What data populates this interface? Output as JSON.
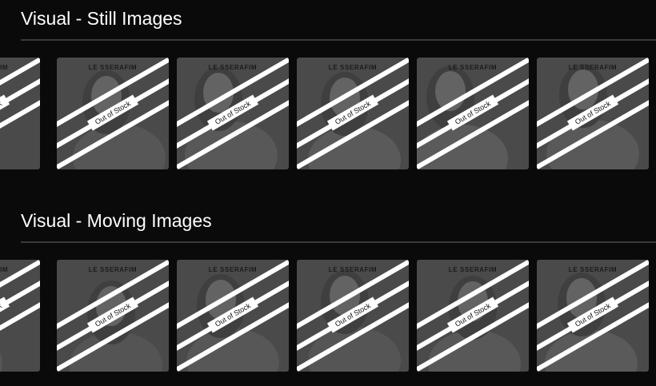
{
  "sections": [
    {
      "title": "Visual - Still Images",
      "items": [
        {
          "brand": "LE SSERAFIM",
          "status": "Out of Stock"
        },
        {
          "brand": "LE SSERAFIM",
          "status": "Out of Stock"
        },
        {
          "brand": "LE SSERAFIM",
          "status": "Out of Stock"
        },
        {
          "brand": "LE SSERAFIM",
          "status": "Out of Stock"
        },
        {
          "brand": "LE SSERAFIM",
          "status": "Out of Stock"
        },
        {
          "brand": "LE SSERAFIM",
          "status": "Out of Stock"
        }
      ]
    },
    {
      "title": "Visual - Moving Images",
      "items": [
        {
          "brand": "LE SSERAFIM",
          "status": "Out of Stock"
        },
        {
          "brand": "LE SSERAFIM",
          "status": "Out of Stock"
        },
        {
          "brand": "LE SSERAFIM",
          "status": "Out of Stock"
        },
        {
          "brand": "LE SSERAFIM",
          "status": "Out of Stock"
        },
        {
          "brand": "LE SSERAFIM",
          "status": "Out of Stock"
        },
        {
          "brand": "LE SSERAFIM",
          "status": "Out of Stock"
        }
      ]
    }
  ],
  "colors": {
    "page_background": "#0a0a0a",
    "card_background": "#4a4a4a",
    "title": "#ffffff",
    "divider": "#3a3a3a",
    "out_of_stock_banner": "#ffffff"
  },
  "icons": {
    "out_of_stock": "crossed-out-of-stock-banner"
  }
}
